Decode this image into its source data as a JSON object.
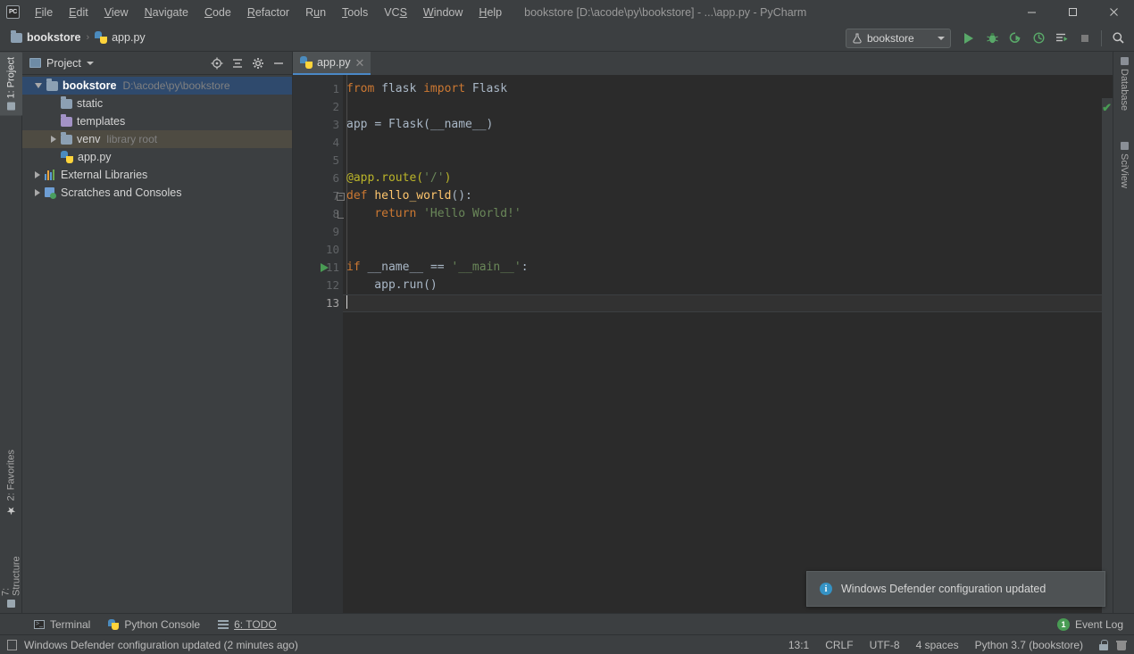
{
  "window": {
    "title": "bookstore [D:\\acode\\py\\bookstore] - ...\\app.py - PyCharm",
    "logo": "PC",
    "minimize": "—",
    "maximize": "□",
    "close": "✕"
  },
  "menubar": {
    "items": [
      {
        "label": "File",
        "mnemonic": "F"
      },
      {
        "label": "Edit",
        "mnemonic": "E"
      },
      {
        "label": "View",
        "mnemonic": "V"
      },
      {
        "label": "Navigate",
        "mnemonic": "N"
      },
      {
        "label": "Code",
        "mnemonic": "C"
      },
      {
        "label": "Refactor",
        "mnemonic": "R"
      },
      {
        "label": "Run",
        "mnemonic": "u"
      },
      {
        "label": "Tools",
        "mnemonic": "T"
      },
      {
        "label": "VCS",
        "mnemonic": "S"
      },
      {
        "label": "Window",
        "mnemonic": "W"
      },
      {
        "label": "Help",
        "mnemonic": "H"
      }
    ]
  },
  "breadcrumb": {
    "project": "bookstore",
    "separator": "›",
    "file": "app.py"
  },
  "toolbar": {
    "run_config": "bookstore",
    "buttons": [
      {
        "name": "run-button",
        "glyph": "▶"
      },
      {
        "name": "debug-button",
        "glyph": "🐞"
      },
      {
        "name": "run-coverage-button",
        "glyph": "▶"
      },
      {
        "name": "profile-button",
        "glyph": "◴"
      },
      {
        "name": "run-with-console-button",
        "glyph": "▤"
      },
      {
        "name": "stop-button",
        "glyph": "■"
      },
      {
        "name": "search-everywhere-button",
        "glyph": "🔍"
      }
    ]
  },
  "left_strip": {
    "project_tab": "1: Project",
    "favorites_tab": "2: Favorites",
    "structure_tab": "7: Structure"
  },
  "right_strip": {
    "database_tab": "Database",
    "sciview_tab": "SciView"
  },
  "project_panel": {
    "title": "Project",
    "actions": [
      {
        "name": "select-opened-file-button",
        "glyph": "✥"
      },
      {
        "name": "collapse-all-button",
        "glyph": "≢"
      },
      {
        "name": "settings-gear-button",
        "glyph": "⚙"
      },
      {
        "name": "hide-panel-button",
        "glyph": "—"
      }
    ],
    "tree": [
      {
        "label": "bookstore",
        "sub": "D:\\acode\\py\\bookstore",
        "icon": "folder-blue",
        "indent": 0,
        "expander": "down",
        "state": "selected",
        "bold": true
      },
      {
        "label": "static",
        "sub": "",
        "icon": "folder-blue",
        "indent": 1,
        "expander": "none",
        "state": "normal",
        "bold": false
      },
      {
        "label": "templates",
        "sub": "",
        "icon": "folder-purple",
        "indent": 1,
        "expander": "none",
        "state": "normal",
        "bold": false
      },
      {
        "label": "venv",
        "sub": "library root",
        "icon": "folder-blue",
        "indent": 1,
        "expander": "right",
        "state": "highlight",
        "bold": false
      },
      {
        "label": "app.py",
        "sub": "",
        "icon": "python-file",
        "indent": 1,
        "expander": "none",
        "state": "normal",
        "bold": false
      },
      {
        "label": "External Libraries",
        "sub": "",
        "icon": "library",
        "indent": 0,
        "expander": "right",
        "state": "normal",
        "bold": false
      },
      {
        "label": "Scratches and Consoles",
        "sub": "",
        "icon": "scratches",
        "indent": 0,
        "expander": "right",
        "state": "normal",
        "bold": false
      }
    ]
  },
  "editor": {
    "tab": {
      "label": "app.py",
      "close": "✕"
    },
    "inspection_status": "✔",
    "current_line": 13,
    "lines": [
      {
        "n": 1,
        "tokens": [
          {
            "t": "from ",
            "c": "kw"
          },
          {
            "t": "flask ",
            "c": "def"
          },
          {
            "t": "import ",
            "c": "kw"
          },
          {
            "t": "Flask",
            "c": "def"
          }
        ]
      },
      {
        "n": 2,
        "tokens": []
      },
      {
        "n": 3,
        "tokens": [
          {
            "t": "app ",
            "c": "def"
          },
          {
            "t": "= ",
            "c": "def"
          },
          {
            "t": "Flask(__name__)",
            "c": "def"
          }
        ]
      },
      {
        "n": 4,
        "tokens": []
      },
      {
        "n": 5,
        "tokens": []
      },
      {
        "n": 6,
        "tokens": [
          {
            "t": "@app.route(",
            "c": "dec"
          },
          {
            "t": "'/'",
            "c": "str"
          },
          {
            "t": ")",
            "c": "dec"
          }
        ]
      },
      {
        "n": 7,
        "tokens": [
          {
            "t": "def ",
            "c": "kw"
          },
          {
            "t": "hello_world",
            "c": "fn"
          },
          {
            "t": "():",
            "c": "def"
          }
        ]
      },
      {
        "n": 8,
        "tokens": [
          {
            "t": "    ",
            "c": "def"
          },
          {
            "t": "return ",
            "c": "kw"
          },
          {
            "t": "'Hello World!'",
            "c": "str"
          }
        ]
      },
      {
        "n": 9,
        "tokens": []
      },
      {
        "n": 10,
        "tokens": []
      },
      {
        "n": 11,
        "tokens": [
          {
            "t": "if ",
            "c": "kw"
          },
          {
            "t": "__name__ ",
            "c": "def"
          },
          {
            "t": "== ",
            "c": "def"
          },
          {
            "t": "'__main__'",
            "c": "str"
          },
          {
            "t": ":",
            "c": "def"
          }
        ]
      },
      {
        "n": 12,
        "tokens": [
          {
            "t": "    app.run()",
            "c": "def"
          }
        ]
      },
      {
        "n": 13,
        "tokens": []
      }
    ],
    "run_marker_line": 11,
    "fold_lines": [
      7,
      8
    ]
  },
  "notification": {
    "icon": "i",
    "text": "Windows Defender configuration updated"
  },
  "bottom_bar": {
    "items": [
      {
        "label": "Terminal",
        "icon": "terminal-icon"
      },
      {
        "label": "Python Console",
        "icon": "python-icon"
      },
      {
        "label": "6: TODO",
        "icon": "todo-icon"
      }
    ],
    "event_log": {
      "label": "Event Log",
      "count": "1"
    }
  },
  "status_bar": {
    "message": "Windows Defender configuration updated (2 minutes ago)",
    "caret": "13:1",
    "line_separator": "CRLF",
    "encoding": "UTF-8",
    "indent": "4 spaces",
    "interpreter": "Python 3.7 (bookstore)"
  },
  "colors": {
    "bg": "#3c3f41",
    "editor_bg": "#2b2b2b",
    "gutter_bg": "#313335",
    "selection": "#2f4a6d",
    "accent": "#4a88c7",
    "green": "#499c54",
    "keyword": "#cc7832",
    "string": "#6a8759",
    "function": "#ffc66d",
    "decorator": "#bbb529",
    "text": "#a9b7c6"
  }
}
